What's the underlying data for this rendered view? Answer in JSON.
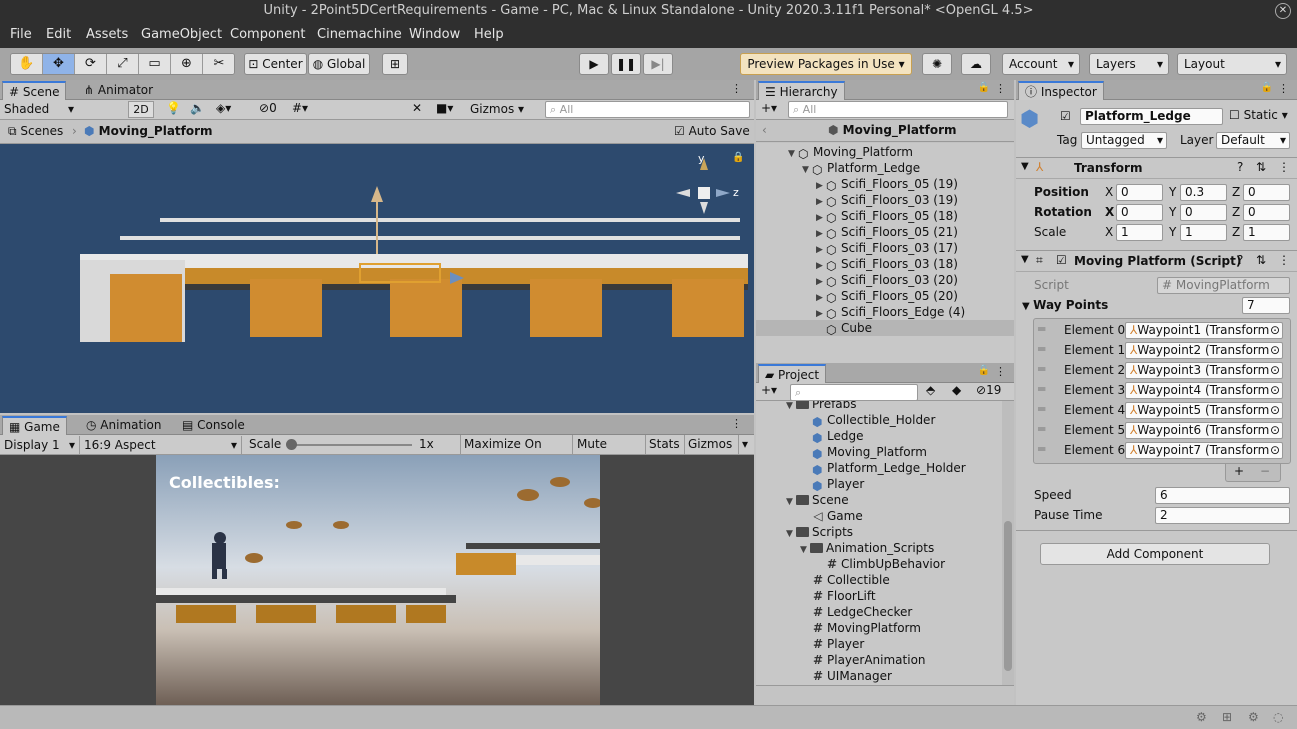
{
  "window": {
    "title": "Unity - 2Point5DCertRequirements - Game - PC, Mac & Linux Standalone - Unity 2020.3.11f1 Personal* <OpenGL 4.5>"
  },
  "menu": [
    "File",
    "Edit",
    "Assets",
    "GameObject",
    "Component",
    "Cinemachine",
    "Window",
    "Help"
  ],
  "toolbar": {
    "center": "Center",
    "global": "Global",
    "preview": "Preview Packages in Use",
    "account": "Account",
    "layers": "Layers",
    "layout": "Layout"
  },
  "scene": {
    "tabs": [
      "Scene",
      "Animator"
    ],
    "shaded": "Shaded",
    "twod": "2D",
    "hidden_count": "0",
    "gizmos": "Gizmos",
    "search_placeholder": "All",
    "breadcrumb_root": "Scenes",
    "breadcrumb_current": "Moving_Platform",
    "autosave": "Auto Save",
    "gizmo_y": "y",
    "gizmo_z": "z",
    "bg": "#2d4a6e"
  },
  "game": {
    "tabs": [
      "Game",
      "Animation",
      "Console"
    ],
    "display": "Display 1",
    "aspect": "16:9 Aspect",
    "scale_label": "Scale",
    "scale_value": "1x",
    "maximize": "Maximize On Play",
    "mute": "Mute Audio",
    "stats": "Stats",
    "gizmos": "Gizmos",
    "hud": "Collectibles:"
  },
  "hierarchy": {
    "title": "Hierarchy",
    "search_placeholder": "All",
    "scene_name": "Moving_Platform",
    "items": [
      {
        "label": "Moving_Platform"
      },
      {
        "label": "Platform_Ledge"
      },
      {
        "label": "Scifi_Floors_05 (19)"
      },
      {
        "label": "Scifi_Floors_03 (19)"
      },
      {
        "label": "Scifi_Floors_05 (18)"
      },
      {
        "label": "Scifi_Floors_05 (21)"
      },
      {
        "label": "Scifi_Floors_03 (17)"
      },
      {
        "label": "Scifi_Floors_03 (18)"
      },
      {
        "label": "Scifi_Floors_03 (20)"
      },
      {
        "label": "Scifi_Floors_05 (20)"
      },
      {
        "label": "Scifi_Floors_Edge (4)"
      },
      {
        "label": "Cube"
      }
    ]
  },
  "project": {
    "title": "Project",
    "hidden_count": "19",
    "items": [
      {
        "label": "Prefabs"
      },
      {
        "label": "Collectible_Holder"
      },
      {
        "label": "Ledge"
      },
      {
        "label": "Moving_Platform"
      },
      {
        "label": "Platform_Ledge_Holder"
      },
      {
        "label": "Player"
      },
      {
        "label": "Scene"
      },
      {
        "label": "Game"
      },
      {
        "label": "Scripts"
      },
      {
        "label": "Animation_Scripts"
      },
      {
        "label": "ClimbUpBehavior"
      },
      {
        "label": "Collectible"
      },
      {
        "label": "FloorLift"
      },
      {
        "label": "LedgeChecker"
      },
      {
        "label": "MovingPlatform"
      },
      {
        "label": "Player"
      },
      {
        "label": "PlayerAnimation"
      },
      {
        "label": "UIManager"
      }
    ]
  },
  "inspector": {
    "title": "Inspector",
    "object_name": "Platform_Ledge",
    "static_label": "Static",
    "tag_label": "Tag",
    "tag_value": "Untagged",
    "layer_label": "Layer",
    "layer_value": "Default",
    "transform": {
      "title": "Transform",
      "position_label": "Position",
      "rotation_label": "Rotation",
      "scale_label": "Scale",
      "position": [
        "0",
        "0.3",
        "0"
      ],
      "rotation": [
        "0",
        "0",
        "0"
      ],
      "scale": [
        "1",
        "1",
        "1"
      ],
      "axes": [
        "X",
        "Y",
        "Z"
      ]
    },
    "script": {
      "title": "Moving Platform (Script)",
      "script_label": "Script",
      "script_value": "MovingPlatform",
      "waypoints_label": "Way Points",
      "waypoints_count": "7",
      "elements": [
        {
          "label": "Element 0",
          "value": "Waypoint1 (Transform"
        },
        {
          "label": "Element 1",
          "value": "Waypoint2 (Transform"
        },
        {
          "label": "Element 2",
          "value": "Waypoint3 (Transform"
        },
        {
          "label": "Element 3",
          "value": "Waypoint4 (Transform"
        },
        {
          "label": "Element 4",
          "value": "Waypoint5 (Transform"
        },
        {
          "label": "Element 5",
          "value": "Waypoint6 (Transform"
        },
        {
          "label": "Element 6",
          "value": "Waypoint7 (Transform"
        }
      ],
      "speed_label": "Speed",
      "speed_value": "6",
      "pause_label": "Pause Time",
      "pause_value": "2"
    },
    "add_component": "Add Component"
  }
}
